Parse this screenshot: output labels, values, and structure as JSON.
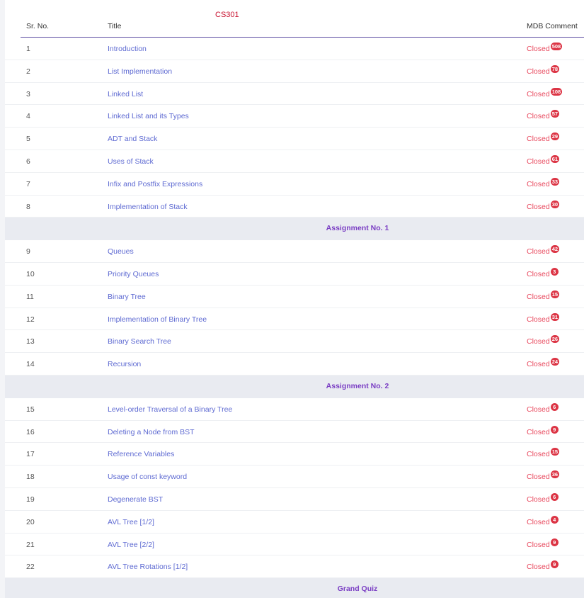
{
  "course": {
    "code": "CS301"
  },
  "table": {
    "headers": {
      "sr_no": "Sr. No.",
      "title": "Title",
      "comment": "MDB Comment"
    }
  },
  "sections": [
    {
      "rows": [
        {
          "no": "1",
          "title": "Introduction",
          "status": "Closed",
          "count": "508"
        },
        {
          "no": "2",
          "title": "List Implementation",
          "status": "Closed",
          "count": "78"
        },
        {
          "no": "3",
          "title": "Linked List",
          "status": "Closed",
          "count": "108"
        },
        {
          "no": "4",
          "title": "Linked List and its Types",
          "status": "Closed",
          "count": "57"
        },
        {
          "no": "5",
          "title": "ADT and Stack",
          "status": "Closed",
          "count": "29"
        },
        {
          "no": "6",
          "title": "Uses of Stack",
          "status": "Closed",
          "count": "61"
        },
        {
          "no": "7",
          "title": "Infix and Postfix Expressions",
          "status": "Closed",
          "count": "33"
        },
        {
          "no": "8",
          "title": "Implementation of Stack",
          "status": "Closed",
          "count": "30"
        }
      ],
      "after": "Assignment No. 1"
    },
    {
      "rows": [
        {
          "no": "9",
          "title": "Queues",
          "status": "Closed",
          "count": "42"
        },
        {
          "no": "10",
          "title": "Priority Queues",
          "status": "Closed",
          "count": "3"
        },
        {
          "no": "11",
          "title": "Binary Tree",
          "status": "Closed",
          "count": "15"
        },
        {
          "no": "12",
          "title": "Implementation of Binary Tree",
          "status": "Closed",
          "count": "31"
        },
        {
          "no": "13",
          "title": "Binary Search Tree",
          "status": "Closed",
          "count": "26"
        },
        {
          "no": "14",
          "title": "Recursion",
          "status": "Closed",
          "count": "24"
        }
      ],
      "after": "Assignment No. 2"
    },
    {
      "rows": [
        {
          "no": "15",
          "title": "Level-order Traversal of a Binary Tree",
          "status": "Closed",
          "count": "6"
        },
        {
          "no": "16",
          "title": "Deleting a Node from BST",
          "status": "Closed",
          "count": "9"
        },
        {
          "no": "17",
          "title": "Reference Variables",
          "status": "Closed",
          "count": "15"
        },
        {
          "no": "18",
          "title": "Usage of const keyword",
          "status": "Closed",
          "count": "36"
        },
        {
          "no": "19",
          "title": "Degenerate BST",
          "status": "Closed",
          "count": "6"
        },
        {
          "no": "20",
          "title": "AVL Tree [1/2]",
          "status": "Closed",
          "count": "4"
        },
        {
          "no": "21",
          "title": "AVL Tree [2/2]",
          "status": "Closed",
          "count": "9"
        },
        {
          "no": "22",
          "title": "AVL Tree Rotations [1/2]",
          "status": "Closed",
          "count": "9"
        }
      ],
      "after": "Grand Quiz"
    }
  ]
}
